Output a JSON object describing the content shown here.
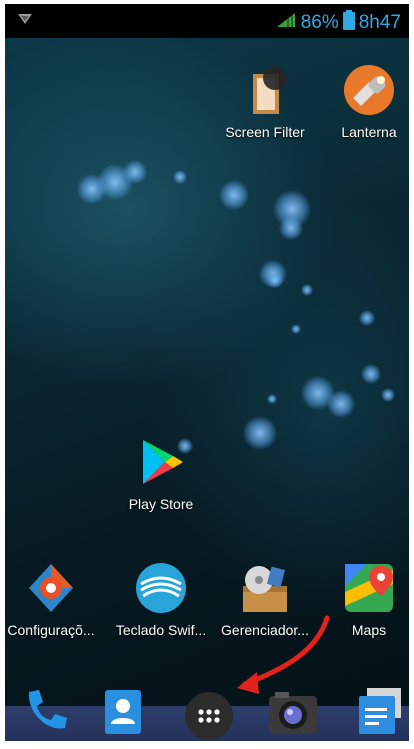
{
  "status_bar": {
    "battery": "86%",
    "time": "8h47"
  },
  "top_apps": [
    {
      "label": "Screen Filter"
    },
    {
      "label": "Lanterna"
    }
  ],
  "middle_apps": [
    {
      "label": "Play Store"
    }
  ],
  "bottom_apps": [
    {
      "label": "Configuraçõ..."
    },
    {
      "label": "Teclado Swif..."
    },
    {
      "label": "Gerenciador..."
    },
    {
      "label": "Maps"
    }
  ],
  "dock": [
    "phone-icon",
    "contacts-icon",
    "app-drawer-icon",
    "camera-icon",
    "messaging-icon"
  ],
  "colors": {
    "status_accent": "#2fa8e6",
    "annotation_arrow": "#e3231b",
    "dock": "#2a3866"
  }
}
